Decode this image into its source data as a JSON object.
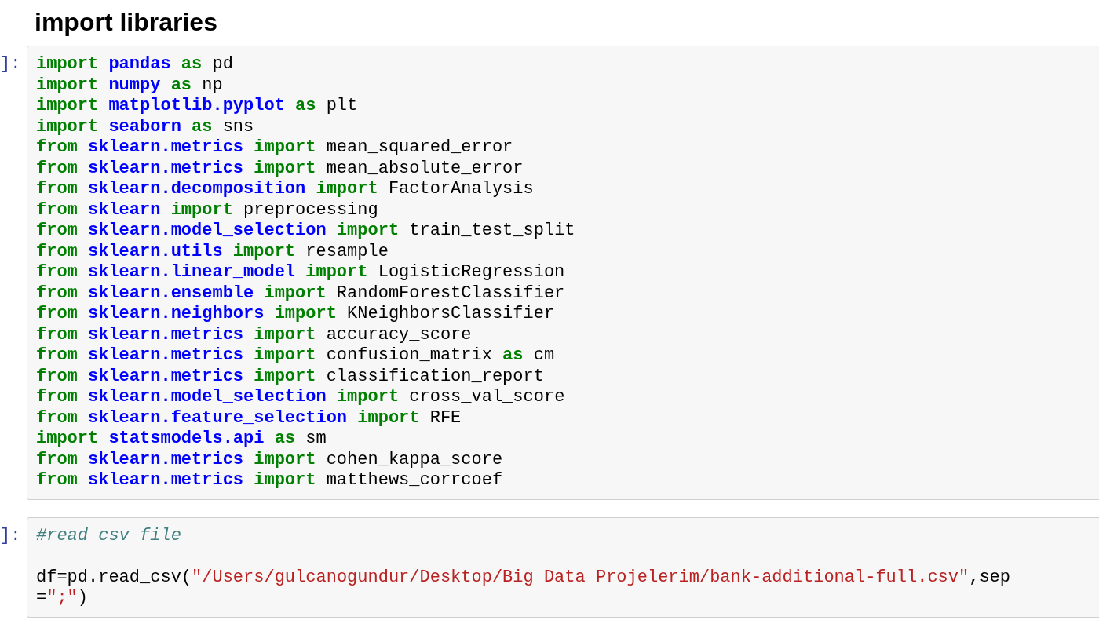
{
  "heading": "import libraries",
  "cells": [
    {
      "prompt": "]:",
      "lines": [
        {
          "tokens": [
            {
              "kind": "keyword",
              "text": "import"
            },
            {
              "kind": "module",
              "text": " pandas"
            },
            {
              "kind": "keyword",
              "text": " as"
            },
            {
              "kind": "plain",
              "text": " pd"
            }
          ]
        },
        {
          "tokens": [
            {
              "kind": "keyword",
              "text": "import"
            },
            {
              "kind": "module",
              "text": " numpy"
            },
            {
              "kind": "keyword",
              "text": " as"
            },
            {
              "kind": "plain",
              "text": " np"
            }
          ]
        },
        {
          "tokens": [
            {
              "kind": "keyword",
              "text": "import"
            },
            {
              "kind": "module",
              "text": " matplotlib.pyplot"
            },
            {
              "kind": "keyword",
              "text": " as"
            },
            {
              "kind": "plain",
              "text": " plt"
            }
          ]
        },
        {
          "tokens": [
            {
              "kind": "keyword",
              "text": "import"
            },
            {
              "kind": "module",
              "text": " seaborn"
            },
            {
              "kind": "keyword",
              "text": " as"
            },
            {
              "kind": "plain",
              "text": " sns"
            }
          ]
        },
        {
          "tokens": [
            {
              "kind": "keyword",
              "text": "from"
            },
            {
              "kind": "module",
              "text": " sklearn.metrics"
            },
            {
              "kind": "keyword",
              "text": " import"
            },
            {
              "kind": "plain",
              "text": " mean_squared_error"
            }
          ]
        },
        {
          "tokens": [
            {
              "kind": "keyword",
              "text": "from"
            },
            {
              "kind": "module",
              "text": " sklearn.metrics"
            },
            {
              "kind": "keyword",
              "text": " import"
            },
            {
              "kind": "plain",
              "text": " mean_absolute_error"
            }
          ]
        },
        {
          "tokens": [
            {
              "kind": "keyword",
              "text": "from"
            },
            {
              "kind": "module",
              "text": " sklearn.decomposition"
            },
            {
              "kind": "keyword",
              "text": " import"
            },
            {
              "kind": "plain",
              "text": " FactorAnalysis"
            }
          ]
        },
        {
          "tokens": [
            {
              "kind": "keyword",
              "text": "from"
            },
            {
              "kind": "module",
              "text": " sklearn"
            },
            {
              "kind": "keyword",
              "text": " import"
            },
            {
              "kind": "plain",
              "text": " preprocessing"
            }
          ]
        },
        {
          "tokens": [
            {
              "kind": "keyword",
              "text": "from"
            },
            {
              "kind": "module",
              "text": " sklearn.model_selection"
            },
            {
              "kind": "keyword",
              "text": " import"
            },
            {
              "kind": "plain",
              "text": " train_test_split"
            }
          ]
        },
        {
          "tokens": [
            {
              "kind": "keyword",
              "text": "from"
            },
            {
              "kind": "module",
              "text": " sklearn.utils"
            },
            {
              "kind": "keyword",
              "text": " import"
            },
            {
              "kind": "plain",
              "text": " resample"
            }
          ]
        },
        {
          "tokens": [
            {
              "kind": "keyword",
              "text": "from"
            },
            {
              "kind": "module",
              "text": " sklearn.linear_model"
            },
            {
              "kind": "keyword",
              "text": " import"
            },
            {
              "kind": "plain",
              "text": " LogisticRegression"
            }
          ]
        },
        {
          "tokens": [
            {
              "kind": "keyword",
              "text": "from"
            },
            {
              "kind": "module",
              "text": " sklearn.ensemble"
            },
            {
              "kind": "keyword",
              "text": " import"
            },
            {
              "kind": "plain",
              "text": " RandomForestClassifier"
            }
          ]
        },
        {
          "tokens": [
            {
              "kind": "keyword",
              "text": "from"
            },
            {
              "kind": "module",
              "text": " sklearn.neighbors"
            },
            {
              "kind": "keyword",
              "text": " import"
            },
            {
              "kind": "plain",
              "text": " KNeighborsClassifier"
            }
          ]
        },
        {
          "tokens": [
            {
              "kind": "keyword",
              "text": "from"
            },
            {
              "kind": "module",
              "text": " sklearn.metrics"
            },
            {
              "kind": "keyword",
              "text": " import"
            },
            {
              "kind": "plain",
              "text": " accuracy_score"
            }
          ]
        },
        {
          "tokens": [
            {
              "kind": "keyword",
              "text": "from"
            },
            {
              "kind": "module",
              "text": " sklearn.metrics"
            },
            {
              "kind": "keyword",
              "text": " import"
            },
            {
              "kind": "plain",
              "text": " confusion_matrix"
            },
            {
              "kind": "keyword",
              "text": " as"
            },
            {
              "kind": "plain",
              "text": " cm"
            }
          ]
        },
        {
          "tokens": [
            {
              "kind": "keyword",
              "text": "from"
            },
            {
              "kind": "module",
              "text": " sklearn.metrics"
            },
            {
              "kind": "keyword",
              "text": " import"
            },
            {
              "kind": "plain",
              "text": " classification_report"
            }
          ]
        },
        {
          "tokens": [
            {
              "kind": "keyword",
              "text": "from"
            },
            {
              "kind": "module",
              "text": " sklearn.model_selection"
            },
            {
              "kind": "keyword",
              "text": " import"
            },
            {
              "kind": "plain",
              "text": " cross_val_score"
            }
          ]
        },
        {
          "tokens": [
            {
              "kind": "keyword",
              "text": "from"
            },
            {
              "kind": "module",
              "text": " sklearn.feature_selection"
            },
            {
              "kind": "keyword",
              "text": " import"
            },
            {
              "kind": "plain",
              "text": " RFE"
            }
          ]
        },
        {
          "tokens": [
            {
              "kind": "keyword",
              "text": "import"
            },
            {
              "kind": "module",
              "text": " statsmodels.api"
            },
            {
              "kind": "keyword",
              "text": " as"
            },
            {
              "kind": "plain",
              "text": " sm"
            }
          ]
        },
        {
          "tokens": [
            {
              "kind": "keyword",
              "text": "from"
            },
            {
              "kind": "module",
              "text": " sklearn.metrics"
            },
            {
              "kind": "keyword",
              "text": " import"
            },
            {
              "kind": "plain",
              "text": " cohen_kappa_score"
            }
          ]
        },
        {
          "tokens": [
            {
              "kind": "keyword",
              "text": "from"
            },
            {
              "kind": "module",
              "text": " sklearn.metrics"
            },
            {
              "kind": "keyword",
              "text": " import"
            },
            {
              "kind": "plain",
              "text": " matthews_corrcoef"
            }
          ]
        }
      ]
    },
    {
      "prompt": "]:",
      "lines": [
        {
          "tokens": [
            {
              "kind": "comment",
              "text": "#read csv file"
            }
          ]
        },
        {
          "kind": "blank"
        },
        {
          "tokens": [
            {
              "kind": "plain",
              "text": "df=pd.read_csv("
            },
            {
              "kind": "string",
              "text": "\"/Users/gulcanogundur/Desktop/Big Data Projelerim/bank-additional-full.csv\""
            },
            {
              "kind": "plain",
              "text": ",sep"
            }
          ]
        },
        {
          "tokens": [
            {
              "kind": "plain",
              "text": "="
            },
            {
              "kind": "string",
              "text": "\";\""
            },
            {
              "kind": "plain",
              "text": ")"
            }
          ]
        }
      ]
    }
  ]
}
